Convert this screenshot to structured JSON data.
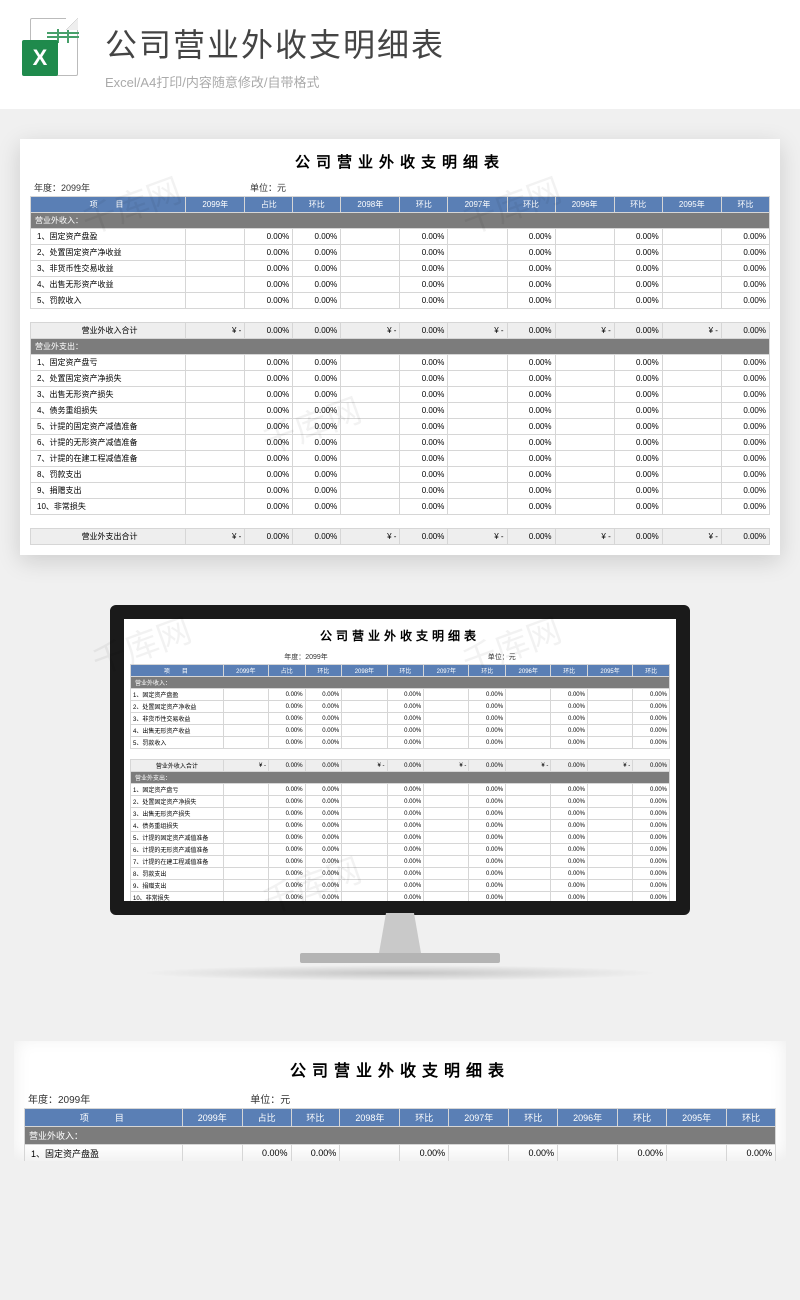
{
  "header": {
    "title": "公司营业外收支明细表",
    "subtitle": "Excel/A4打印/内容随意修改/自带格式",
    "icon_letter": "X"
  },
  "watermark": "千库网",
  "sheet": {
    "title": "公司营业外收支明细表",
    "year_label": "年度：2099年",
    "unit_label": "单位：元",
    "columns": {
      "item": "项目",
      "years": [
        "2099年",
        "2098年",
        "2097年",
        "2096年",
        "2095年"
      ],
      "pct": "占比",
      "chg": "环比"
    },
    "income_section": "营业外收入：",
    "income_rows": [
      "1、固定资产盘盈",
      "2、处置固定资产净收益",
      "3、非货币性交易收益",
      "4、出售无形资产收益",
      "5、罚款收入"
    ],
    "income_total": "营业外收入合计",
    "expense_section": "营业外支出：",
    "expense_rows": [
      "1、固定资产盘亏",
      "2、处置固定资产净损失",
      "3、出售无形资产损失",
      "4、债务重组损失",
      "5、计提的固定资产减值准备",
      "6、计提的无形资产减值准备",
      "7、计提的在建工程减值准备",
      "8、罚款支出",
      "9、捐赠支出",
      "10、非常损失"
    ],
    "expense_total": "营业外支出合计",
    "zero_pct": "0.00%",
    "yen_dash": "¥    -"
  }
}
